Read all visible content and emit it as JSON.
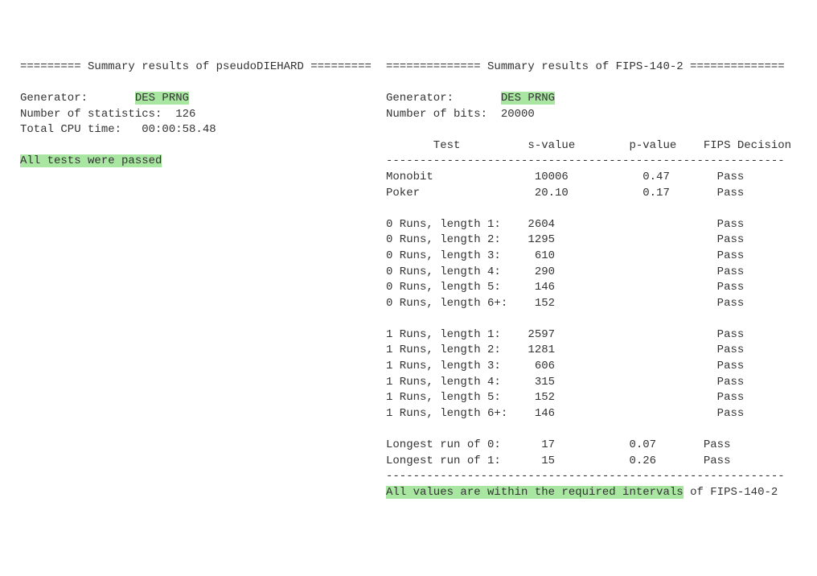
{
  "left": {
    "header": "========= Summary results of pseudoDIEHARD =========",
    "gen_label": "Generator:       ",
    "gen_value": "DES PRNG",
    "stats": "Number of statistics:  126",
    "cpu": "Total CPU time:   00:00:58.48",
    "passed": "All tests were passed"
  },
  "right": {
    "header": "============== Summary results of FIPS-140-2 ==============",
    "gen_label": "Generator:       ",
    "gen_value": "DES PRNG",
    "bits": "Number of bits:  20000",
    "cols": "       Test          s-value        p-value    FIPS Decision",
    "sep": "-----------------------------------------------------------",
    "rows": [
      "Monobit               10006           0.47       Pass",
      "Poker                 20.10           0.17       Pass",
      "",
      "0 Runs, length 1:    2604                        Pass",
      "0 Runs, length 2:    1295                        Pass",
      "0 Runs, length 3:     610                        Pass",
      "0 Runs, length 4:     290                        Pass",
      "0 Runs, length 5:     146                        Pass",
      "0 Runs, length 6+:    152                        Pass",
      "",
      "1 Runs, length 1:    2597                        Pass",
      "1 Runs, length 2:    1281                        Pass",
      "1 Runs, length 3:     606                        Pass",
      "1 Runs, length 4:     315                        Pass",
      "1 Runs, length 5:     152                        Pass",
      "1 Runs, length 6+:    146                        Pass",
      "",
      "Longest run of 0:      17           0.07       Pass",
      "Longest run of 1:      15           0.26       Pass"
    ],
    "sep2": "-----------------------------------------------------------",
    "msg_hl": "All values are within the required intervals",
    "msg_tail": " of FIPS-140-2"
  },
  "chart_data": {
    "type": "table",
    "title": "Summary results of FIPS-140-2",
    "generator": "DES PRNG",
    "number_of_bits": 20000,
    "columns": [
      "Test",
      "s-value",
      "p-value",
      "FIPS Decision"
    ],
    "rows": [
      {
        "Test": "Monobit",
        "s-value": 10006,
        "p-value": 0.47,
        "FIPS Decision": "Pass"
      },
      {
        "Test": "Poker",
        "s-value": 20.1,
        "p-value": 0.17,
        "FIPS Decision": "Pass"
      },
      {
        "Test": "0 Runs, length 1",
        "s-value": 2604,
        "p-value": null,
        "FIPS Decision": "Pass"
      },
      {
        "Test": "0 Runs, length 2",
        "s-value": 1295,
        "p-value": null,
        "FIPS Decision": "Pass"
      },
      {
        "Test": "0 Runs, length 3",
        "s-value": 610,
        "p-value": null,
        "FIPS Decision": "Pass"
      },
      {
        "Test": "0 Runs, length 4",
        "s-value": 290,
        "p-value": null,
        "FIPS Decision": "Pass"
      },
      {
        "Test": "0 Runs, length 5",
        "s-value": 146,
        "p-value": null,
        "FIPS Decision": "Pass"
      },
      {
        "Test": "0 Runs, length 6+",
        "s-value": 152,
        "p-value": null,
        "FIPS Decision": "Pass"
      },
      {
        "Test": "1 Runs, length 1",
        "s-value": 2597,
        "p-value": null,
        "FIPS Decision": "Pass"
      },
      {
        "Test": "1 Runs, length 2",
        "s-value": 1281,
        "p-value": null,
        "FIPS Decision": "Pass"
      },
      {
        "Test": "1 Runs, length 3",
        "s-value": 606,
        "p-value": null,
        "FIPS Decision": "Pass"
      },
      {
        "Test": "1 Runs, length 4",
        "s-value": 315,
        "p-value": null,
        "FIPS Decision": "Pass"
      },
      {
        "Test": "1 Runs, length 5",
        "s-value": 152,
        "p-value": null,
        "FIPS Decision": "Pass"
      },
      {
        "Test": "1 Runs, length 6+",
        "s-value": 146,
        "p-value": null,
        "FIPS Decision": "Pass"
      },
      {
        "Test": "Longest run of 0",
        "s-value": 17,
        "p-value": 0.07,
        "FIPS Decision": "Pass"
      },
      {
        "Test": "Longest run of 1",
        "s-value": 15,
        "p-value": 0.26,
        "FIPS Decision": "Pass"
      }
    ],
    "pseudoDIEHARD": {
      "generator": "DES PRNG",
      "number_of_statistics": 126,
      "total_cpu_time": "00:00:58.48",
      "result": "All tests were passed"
    }
  }
}
